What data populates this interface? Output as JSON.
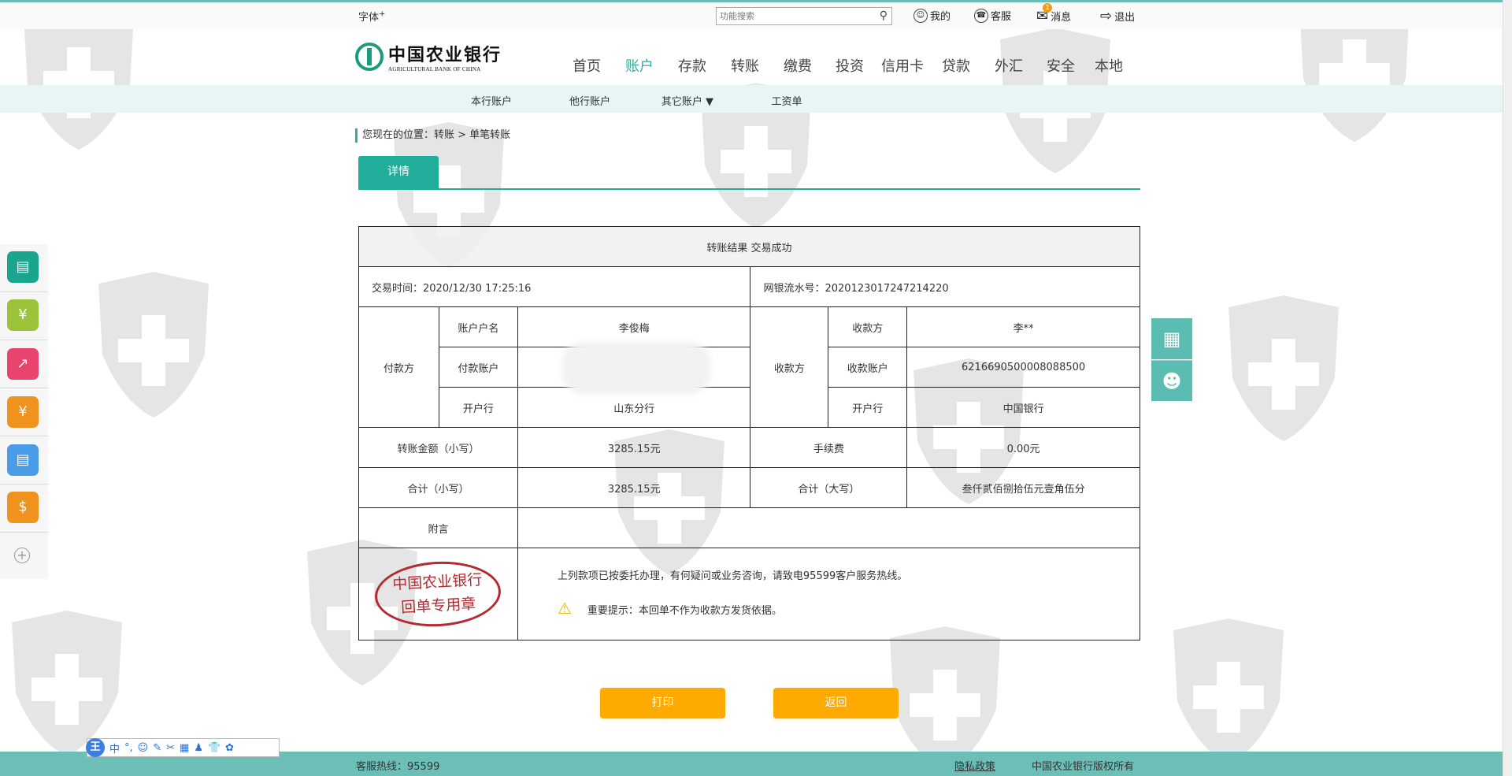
{
  "topbar": {
    "font_label": "字体",
    "font_sup": "+",
    "search_placeholder": "功能搜索",
    "links": [
      {
        "label": "我的",
        "icon": "user-icon"
      },
      {
        "label": "客服",
        "icon": "headset-icon"
      },
      {
        "label": "消息",
        "icon": "mail-icon",
        "badge": "1"
      },
      {
        "label": "退出",
        "icon": "logout-icon"
      }
    ]
  },
  "logo": {
    "cn": "中国农业银行",
    "en": "AGRICULTURAL BANK OF CHINA"
  },
  "nav": [
    "首页",
    "账户",
    "存款",
    "转账",
    "缴费",
    "投资",
    "信用卡",
    "贷款",
    "外汇",
    "安全",
    "本地"
  ],
  "nav_active": "账户",
  "subnav": [
    "本行账户",
    "他行账户",
    "其它账户 ▼",
    "工资单"
  ],
  "breadcrumb": "您现在的位置：转账 > 单笔转账",
  "tab": "详情",
  "receipt": {
    "title": "转账结果 交易成功",
    "time_label": "交易时间：2020/12/30 17:25:16",
    "serial_label": "网银流水号：2020123017247214220",
    "payer_label": "付款方",
    "payee_label": "收款方",
    "payer": {
      "name_label": "账户户名",
      "name": "李俊梅",
      "account_label": "付款账户",
      "account": "",
      "bank_label": "开户行",
      "bank": "山东分行"
    },
    "payee": {
      "name_label": "收款方",
      "name": "李**",
      "account_label": "收款账户",
      "account": "6216690500008088500",
      "bank_label": "开户行",
      "bank": "中国银行"
    },
    "amount_label": "转账金额（小写）",
    "amount": "3285.15元",
    "fee_label": "手续费",
    "fee": "0.00元",
    "total_label": "合计（小写）",
    "total": "3285.15元",
    "total_cap_label": "合计（大写）",
    "total_cap": "叁仟贰佰捌拾伍元壹角伍分",
    "memo_label": "附言",
    "memo": "",
    "stamp_line1": "中国农业银行",
    "stamp_line2": "回单专用章",
    "note1": "上列款项已按委托办理，有何疑问或业务咨询，请致电95599客户服务热线。",
    "note2": "重要提示：本回单不作为收款方发货依据。"
  },
  "buttons": {
    "print": "打印",
    "back": "返回"
  },
  "footer": {
    "hotline": "客服热线：95599",
    "privacy": "隐私政策",
    "copyright": "中国农业银行版权所有"
  },
  "ime": {
    "logo": "王",
    "items": [
      "中",
      "°,",
      "☺",
      "✎",
      "✂",
      "▦",
      "♟",
      "👕",
      "✿"
    ]
  },
  "colors": {
    "accent": "#20ae9b",
    "button": "#ffaa00",
    "footer": "#6bbfb6",
    "stamp": "#b32a33"
  }
}
